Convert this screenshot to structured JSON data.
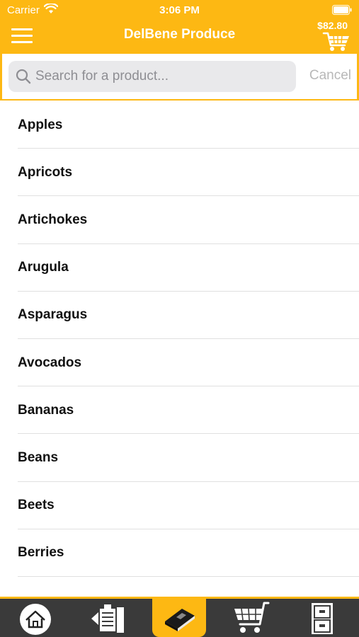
{
  "status_bar": {
    "carrier": "Carrier",
    "time": "3:06 PM"
  },
  "nav": {
    "title": "DelBene Produce",
    "cart_total": "$82.80"
  },
  "search": {
    "placeholder": "Search for a product...",
    "cancel_label": "Cancel"
  },
  "products": [
    "Apples",
    "Apricots",
    "Artichokes",
    "Arugula",
    "Asparagus",
    "Avocados",
    "Bananas",
    "Beans",
    "Beets",
    "Berries"
  ],
  "tabs": [
    {
      "icon": "home-icon",
      "active": false
    },
    {
      "icon": "order-list-icon",
      "active": false
    },
    {
      "icon": "catalog-book-icon",
      "active": true
    },
    {
      "icon": "cart-icon",
      "active": false
    },
    {
      "icon": "cabinet-icon",
      "active": false
    }
  ],
  "colors": {
    "brand": "#FDB813",
    "tab_bar": "#3A3A3A",
    "list_text": "#111111",
    "search_bg": "#E9E9EB"
  }
}
